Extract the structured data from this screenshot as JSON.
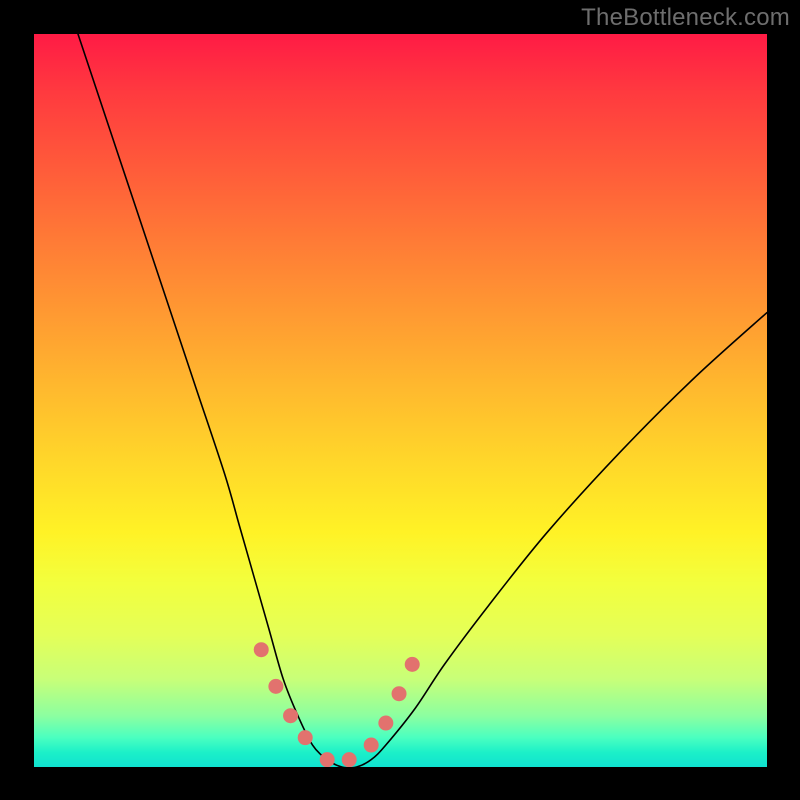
{
  "watermark_text": "TheBottleneck.com",
  "chart_data": {
    "type": "line",
    "title": "",
    "xlabel": "",
    "ylabel": "",
    "xlim": [
      0,
      100
    ],
    "ylim": [
      0,
      100
    ],
    "background": "rainbow-gradient-red-to-green",
    "grid": false,
    "series": [
      {
        "name": "bottleneck-curve",
        "x": [
          6,
          10,
          14,
          18,
          22,
          26,
          28,
          30,
          32,
          34,
          36,
          38,
          40,
          42,
          44,
          46,
          48,
          52,
          56,
          62,
          70,
          80,
          90,
          100
        ],
        "y": [
          100,
          88,
          76,
          64,
          52,
          40,
          33,
          26,
          19,
          12,
          7,
          3,
          1,
          0,
          0,
          1,
          3,
          8,
          14,
          22,
          32,
          43,
          53,
          62
        ]
      }
    ],
    "markers": {
      "name": "salmon-dots",
      "color": "#e2726e",
      "x": [
        31,
        33,
        35,
        37,
        40,
        43,
        46,
        48,
        49.8,
        51.6
      ],
      "y": [
        16,
        11,
        7,
        4,
        1,
        1,
        3,
        6,
        10,
        14
      ]
    }
  }
}
